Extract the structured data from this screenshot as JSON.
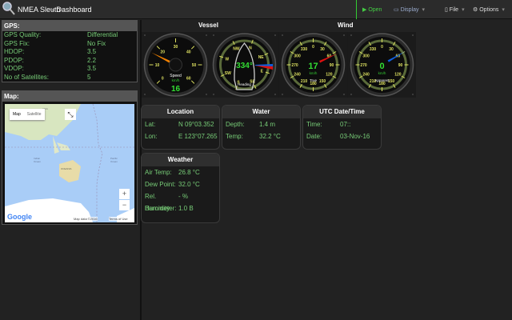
{
  "header": {
    "app_title": "NMEA Sleuth",
    "subtitle": "- Dashboard",
    "nav": {
      "open": "Open",
      "display": "Display",
      "file": "File",
      "options": "Options"
    }
  },
  "gps": {
    "title": "GPS:",
    "rows": [
      {
        "label": "GPS Quality:",
        "value": "Differential"
      },
      {
        "label": "GPS Fix:",
        "value": "No Fix"
      },
      {
        "label": "HDOP:",
        "value": "3.5"
      },
      {
        "label": "PDOP:",
        "value": "2.2"
      },
      {
        "label": "VDOP:",
        "value": "3.5"
      },
      {
        "label": "No of Satellites:",
        "value": "5"
      }
    ]
  },
  "map": {
    "title": "Map:",
    "type_map": "Map",
    "type_satellite": "Satellite",
    "labels": {
      "asia": "ASIA",
      "indian_ocean": "Indian Ocean",
      "oceania": "OCEANIA",
      "pacific": "Pacific Ocean"
    },
    "zoom_in": "+",
    "zoom_out": "−",
    "logo": "Google",
    "attribution": "Map data ©2016",
    "terms": "Terms of Use"
  },
  "sections": {
    "vessel": "Vessel",
    "wind": "Wind"
  },
  "gauges": {
    "speed": {
      "label": "Speed",
      "unit": "km/h",
      "value": "16",
      "ticks": [
        "0",
        "10",
        "20",
        "30",
        "40",
        "50",
        "60"
      ],
      "needle_color": "#f08000"
    },
    "heading": {
      "label": "Heading",
      "value": "334°",
      "ticks": [
        "NW",
        "N",
        "NE",
        "E",
        "SE",
        "S",
        "SW",
        "W"
      ]
    },
    "true_wind": {
      "label": "True",
      "unit": "km/h",
      "value": "17",
      "angle": 65,
      "ticks": [
        "0",
        "30",
        "60",
        "90",
        "120",
        "150",
        "180",
        "210",
        "240",
        "270",
        "300",
        "330"
      ],
      "needle_color": "#e01010"
    },
    "apparent_wind": {
      "label": "Apparent",
      "unit": "km/h",
      "value": "0",
      "angle": 60,
      "ticks": [
        "0",
        "30",
        "60",
        "90",
        "120",
        "150",
        "180",
        "210",
        "240",
        "270",
        "300",
        "330"
      ],
      "needle_color": "#1060e0"
    }
  },
  "location": {
    "title": "Location",
    "rows": [
      {
        "label": "Lat:",
        "value": "N 09°03.352"
      },
      {
        "label": "Lon:",
        "value": "E 123°07.265"
      }
    ]
  },
  "water": {
    "title": "Water",
    "rows": [
      {
        "label": "Depth:",
        "value": "1.4 m"
      },
      {
        "label": "Temp:",
        "value": "32.2 °C"
      }
    ]
  },
  "utc": {
    "title": "UTC Date/Time",
    "rows": [
      {
        "label": "Time:",
        "value": "07::"
      },
      {
        "label": "Date:",
        "value": "03-Nov-16"
      }
    ]
  },
  "weather": {
    "title": "Weather",
    "rows": [
      {
        "label": "Air Temp:",
        "value": "26.8 °C"
      },
      {
        "label": "Dew Point:",
        "value": "32.0 °C"
      },
      {
        "label": "Rel. Humidity:",
        "value": "- %"
      },
      {
        "label": "Barometer:",
        "value": "1.0 B"
      }
    ]
  }
}
